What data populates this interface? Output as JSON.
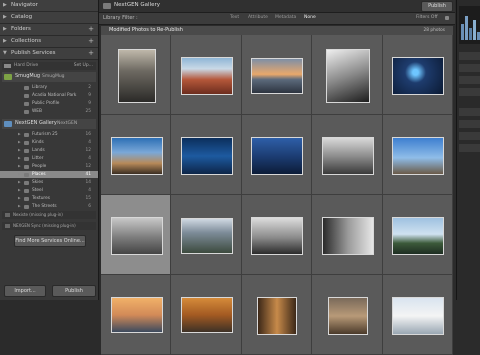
{
  "left_panel": {
    "navigator": {
      "label": "Navigator"
    },
    "catalog": {
      "label": "Catalog"
    },
    "folders": {
      "label": "Folders"
    },
    "collections": {
      "label": "Collections"
    },
    "publish_services": {
      "label": "Publish Services"
    },
    "hard_drive": {
      "label": "Hard Drive",
      "action": "Set Up..."
    },
    "smugmug": {
      "name": "SmugMug",
      "account": "SmugMug"
    },
    "smugmug_items": [
      {
        "name": "Library",
        "count": "2"
      },
      {
        "name": "Acadia National Park",
        "count": "9"
      },
      {
        "name": "Public Profile",
        "count": "9"
      },
      {
        "name": "WEB",
        "count": "25"
      }
    ],
    "nextgen": {
      "name": "NextGEN Gallery",
      "account": "NextGEN"
    },
    "nextgen_items": [
      {
        "name": "Futurism 25",
        "count": "16"
      },
      {
        "name": "Kinds",
        "count": "4"
      },
      {
        "name": "Lands",
        "count": "12"
      },
      {
        "name": "Litter",
        "count": "4"
      },
      {
        "name": "People",
        "count": "12"
      },
      {
        "name": "Places",
        "count": "41",
        "selected": true
      },
      {
        "name": "Skies",
        "count": "14"
      },
      {
        "name": "Steel",
        "count": "4"
      },
      {
        "name": "Textures",
        "count": "15"
      },
      {
        "name": "The Streets",
        "count": "6"
      }
    ],
    "footer_rows": [
      "Nexiste (missing plug-in)",
      "NEXGEN Sync (missing plug-in)"
    ],
    "find_more": "Find More Services Online...",
    "import_button": "Import...",
    "publish_button": "Publish"
  },
  "toolbar": {
    "title": "NextGEN Gallery",
    "publish_button": "Publish"
  },
  "filter_bar": {
    "label": "Library Filter :",
    "tabs": [
      "Text",
      "Attribute",
      "Metadata",
      "None"
    ],
    "active_tab": "None",
    "filters_off": "Filters Off"
  },
  "grid_header": {
    "title": "Modified Photos to Re-Publish",
    "count": "28 photos"
  },
  "thumbnails": [
    {
      "subject": "street-alley"
    },
    {
      "subject": "red-rock"
    },
    {
      "subject": "sunset-shore"
    },
    {
      "subject": "bridge-bw"
    },
    {
      "subject": "ferris-wheel-night"
    },
    {
      "subject": "coast-city"
    },
    {
      "subject": "blue-lake"
    },
    {
      "subject": "blue-dusk"
    },
    {
      "subject": "pier-bw"
    },
    {
      "subject": "pilings"
    },
    {
      "subject": "beach-bw"
    },
    {
      "subject": "mountain-town"
    },
    {
      "subject": "car-bw"
    },
    {
      "subject": "bridge-bw-2"
    },
    {
      "subject": "flooded-trees"
    },
    {
      "subject": "city-skyline"
    },
    {
      "subject": "autumn-cabin"
    },
    {
      "subject": "steel-door"
    },
    {
      "subject": "rust-gate"
    },
    {
      "subject": "lighthouse"
    }
  ],
  "colors": {
    "panel": "#383838",
    "grid": "#555555",
    "selected": "#8d8d8d"
  }
}
